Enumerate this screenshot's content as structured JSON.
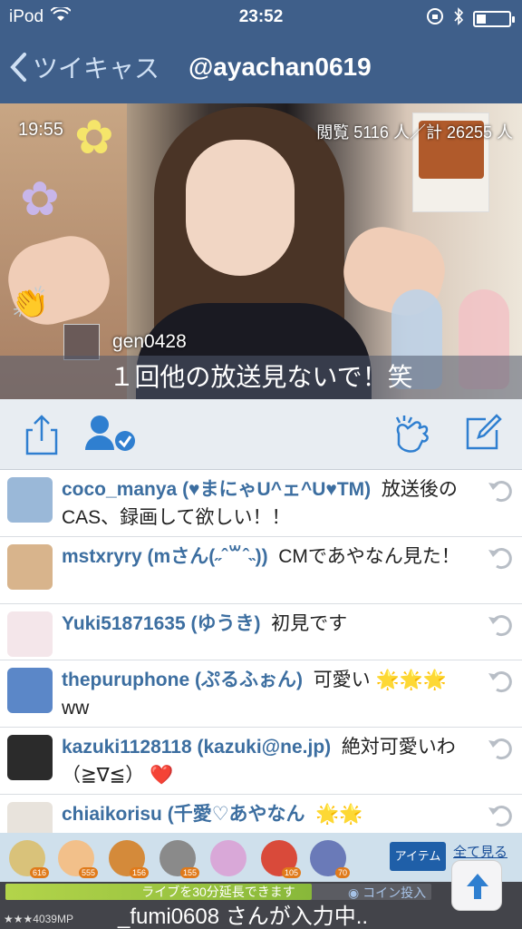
{
  "status": {
    "carrier": "iPod",
    "time": "23:52",
    "battery_level": 0.28,
    "icons": [
      "wifi-icon",
      "rotation-lock-icon",
      "bluetooth-icon",
      "battery-icon"
    ]
  },
  "nav": {
    "back_label": "ツイキャス",
    "title": "@ayachan0619"
  },
  "video": {
    "elapsed": "19:55",
    "stats": "閲覧 5116 人／計 26255 人",
    "commenter": "gen0428",
    "comment": "１回他の放送見ないで！笑"
  },
  "toolbar": {
    "icons": [
      "share-icon",
      "follow-user-icon",
      "clap-icon",
      "compose-icon"
    ]
  },
  "comments": [
    {
      "user": "coco_manya (♥まにゃU^ェ^U♥TM)",
      "text": "放送後のCAS、録画して欲しい！！",
      "avatar_color": "#9ab8d8"
    },
    {
      "user": "mstxryry (mさん(˶ˆ꒳ˆ˵))",
      "text": "CMであやなん見た！",
      "avatar_color": "#d8b48c"
    },
    {
      "user": "Yuki51871635 (ゆうき)",
      "text": "初見です",
      "avatar_color": "#f4e6ea"
    },
    {
      "user": "thepuruphone (ぷるふぉん)",
      "text": "可愛い 🌟🌟🌟 ww",
      "avatar_color": "#5b87c8"
    },
    {
      "user": "kazuki1128118 (kazuki@ne.jp)",
      "text": "絶対可愛いわ（≧∇≦） ❤️",
      "avatar_color": "#2b2b2b"
    },
    {
      "user": "chiaikorisu (千愛♡あやなん",
      "text": "🌟🌟",
      "avatar_color": "#e8e3dc"
    }
  ],
  "items": {
    "counts": [
      "616",
      "555",
      "156",
      "155",
      "",
      "105",
      "70"
    ],
    "colors": [
      "#d9c27a",
      "#f2c08a",
      "#d48a3a",
      "#8a8a8a",
      "#d9a8d8",
      "#d94a3a",
      "#6a7ab8"
    ],
    "item_button": "アイテム",
    "see_all": "全て見る"
  },
  "bottom": {
    "extend_text": "ライブを30分延長できます",
    "extend_progress": 0.72,
    "coin_button": "コイン投入",
    "mp": "4039MP",
    "typing": "_fumi0608 さんが入力中.."
  }
}
